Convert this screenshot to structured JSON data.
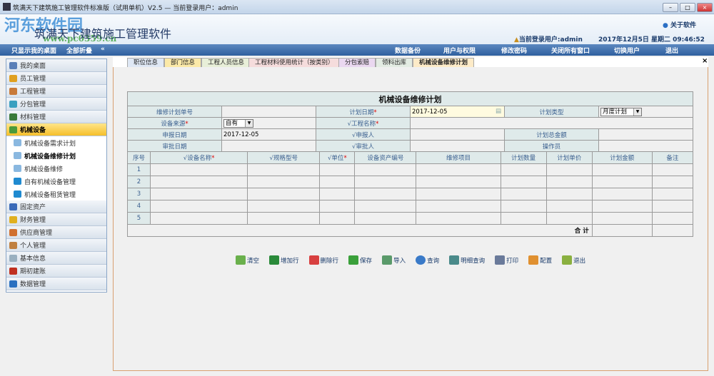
{
  "window": {
    "title": "筑满天下建筑施工管理软件标准版（试用单机）V2.5 — 当前登录用户：admin",
    "minimize": "–",
    "maximize": "□",
    "close": "×"
  },
  "header": {
    "app_name": "筑满天下建筑施工管理软件",
    "about": "关于软件",
    "current_user": "当前登录用户:admin",
    "datetime": "2017年12月5日 星期二 09:46:52",
    "watermark": "河东软件园",
    "watermark_url": "www.pc0359.cn"
  },
  "navbar": {
    "left": [
      "只显示我的桌面",
      "全部折叠"
    ],
    "right": [
      "数据备份",
      "用户与权限",
      "修改密码",
      "关闭所有窗口",
      "切换用户",
      "退出"
    ]
  },
  "sidebar": {
    "items": [
      "我的桌面",
      "员工管理",
      "工程管理",
      "分包管理",
      "材料管理",
      "机械设备"
    ],
    "sub": [
      "机械设备需求计划",
      "机械设备维修计划",
      "机械设备维修",
      "自有机械设备管理",
      "机械设备租赁管理"
    ],
    "items_after": [
      "固定资产",
      "财务管理",
      "供应商管理",
      "个人管理",
      "基本信息",
      "期初建账",
      "数据管理"
    ]
  },
  "tabs": [
    "职位信息",
    "部门信息",
    "工程人员信息",
    "工程材料使用统计（按类别）",
    "分包索赔",
    "领料出库",
    "机械设备维修计划"
  ],
  "tab_close": "×",
  "form": {
    "title": "机械设备维修计划",
    "plan_no_label": "维修计划单号",
    "plan_date_label": "计划日期",
    "plan_date": "2017-12-05",
    "plan_type_label": "计划类型",
    "plan_type": "月度计划",
    "source_label": "设备来源",
    "source": "自有",
    "project_label": "√工程名称",
    "report_date_label": "申报日期",
    "report_date": "2017-12-05",
    "reporter_label": "√申报人",
    "total_label": "计划总金额",
    "approve_date_label": "审批日期",
    "approver_label": "√审批人",
    "operator_label": "操作员",
    "req": "*"
  },
  "table": {
    "headers": [
      "序号",
      "√设备名称",
      "√规格型号",
      "√单位",
      "设备资产编号",
      "维修项目",
      "计划数量",
      "计划单价",
      "计划金额",
      "备注"
    ],
    "rows": [
      "1",
      "2",
      "3",
      "4",
      "5"
    ],
    "total_label": "合 计"
  },
  "actions": [
    "清空",
    "增加行",
    "删除行",
    "保存",
    "导入",
    "查询",
    "明细查询",
    "打印",
    "配置",
    "退出"
  ]
}
